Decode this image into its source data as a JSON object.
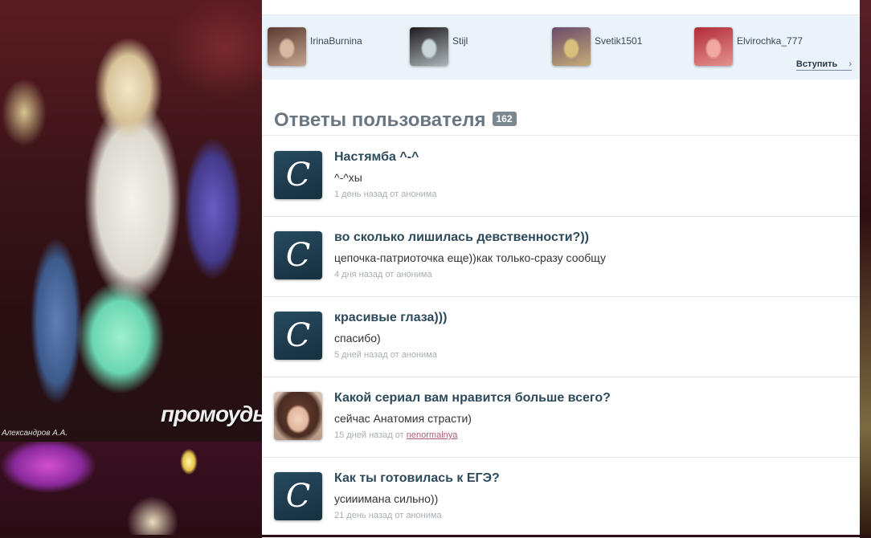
{
  "background": {
    "watermark_text": "промоуды",
    "signature_text": "Александров А.А."
  },
  "members": [
    {
      "name": "IrinaBurnina",
      "avatar_colors": [
        "#5a3a30",
        "#d9b8a2"
      ]
    },
    {
      "name": "Stijl",
      "avatar_colors": [
        "#1f1a1c",
        "#c8d6da"
      ]
    },
    {
      "name": "Svetik1501",
      "avatar_colors": [
        "#6a4a6a",
        "#d8c07a"
      ]
    },
    {
      "name": "Elvirochka_777",
      "avatar_colors": [
        "#b02a3a",
        "#f0a8a0"
      ]
    }
  ],
  "join_label": "Вступить",
  "join_chevron": "›",
  "section": {
    "title": "Ответы пользователя",
    "count": "162"
  },
  "answers": [
    {
      "question": "Настямба ^-^",
      "answer": "^-^хы",
      "meta_prefix": "1 день назад от анонима",
      "meta_user": "",
      "avatar": "logo",
      "avatar_glyph": "C"
    },
    {
      "question": "во сколько лишилась девственности?))",
      "answer": "цепочка-патриоточка еще))как только-сразу сообщу",
      "meta_prefix": "4 дня назад от анонима",
      "meta_user": "",
      "avatar": "logo",
      "avatar_glyph": "C"
    },
    {
      "question": "красивые глаза)))",
      "answer": "спасибо)",
      "meta_prefix": "5 дней назад от анонима",
      "meta_user": "",
      "avatar": "logo",
      "avatar_glyph": "C"
    },
    {
      "question": "Какой сериал вам нравится больше всего?",
      "answer": "сейчас Анатомия страсти)",
      "meta_prefix": "15 дней назад от ",
      "meta_user": "nenormalnya",
      "avatar": "photo",
      "avatar_glyph": ""
    },
    {
      "question": "Как ты готовилась к ЕГЭ?",
      "answer": "усииимана сильно))",
      "meta_prefix": "21 день назад от анонима",
      "meta_user": "",
      "avatar": "logo",
      "avatar_glyph": "C"
    }
  ]
}
